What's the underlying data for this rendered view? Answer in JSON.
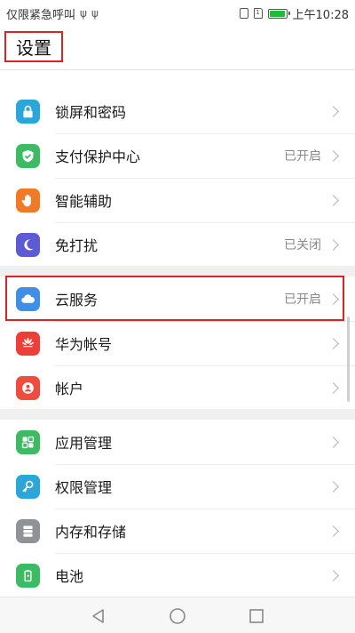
{
  "status_bar": {
    "carrier": "仅限紧急呼叫",
    "usb_symbol": "ψ",
    "sim_label": "1",
    "time": "上午10:28"
  },
  "header": {
    "title": "设置"
  },
  "groups": [
    {
      "items": [
        {
          "label": "锁屏和密码",
          "status": "",
          "icon": "lock-icon",
          "color": "#2aa7d8"
        },
        {
          "label": "支付保护中心",
          "status": "已开启",
          "icon": "shield-check-icon",
          "color": "#3dbb63"
        },
        {
          "label": "智能辅助",
          "status": "",
          "icon": "hand-icon",
          "color": "#f07a27"
        },
        {
          "label": "免打扰",
          "status": "已关闭",
          "icon": "moon-icon",
          "color": "#5c5bd4"
        }
      ]
    },
    {
      "items": [
        {
          "label": "云服务",
          "status": "已开启",
          "icon": "cloud-icon",
          "color": "#3f8fe6"
        },
        {
          "label": "华为帐号",
          "status": "",
          "icon": "huawei-logo-icon",
          "color": "#ef3e37"
        },
        {
          "label": "帐户",
          "status": "",
          "icon": "user-icon",
          "color": "#ef4b3f"
        }
      ]
    },
    {
      "items": [
        {
          "label": "应用管理",
          "status": "",
          "icon": "apps-grid-icon",
          "color": "#3dbb63"
        },
        {
          "label": "权限管理",
          "status": "",
          "icon": "key-icon",
          "color": "#2aa7d8"
        },
        {
          "label": "内存和存储",
          "status": "",
          "icon": "storage-icon",
          "color": "#8f9398"
        },
        {
          "label": "电池",
          "status": "",
          "icon": "battery-icon",
          "color": "#3dbb63"
        }
      ]
    }
  ],
  "nav": {
    "back": "back-icon",
    "home": "home-icon",
    "recents": "recents-icon"
  }
}
